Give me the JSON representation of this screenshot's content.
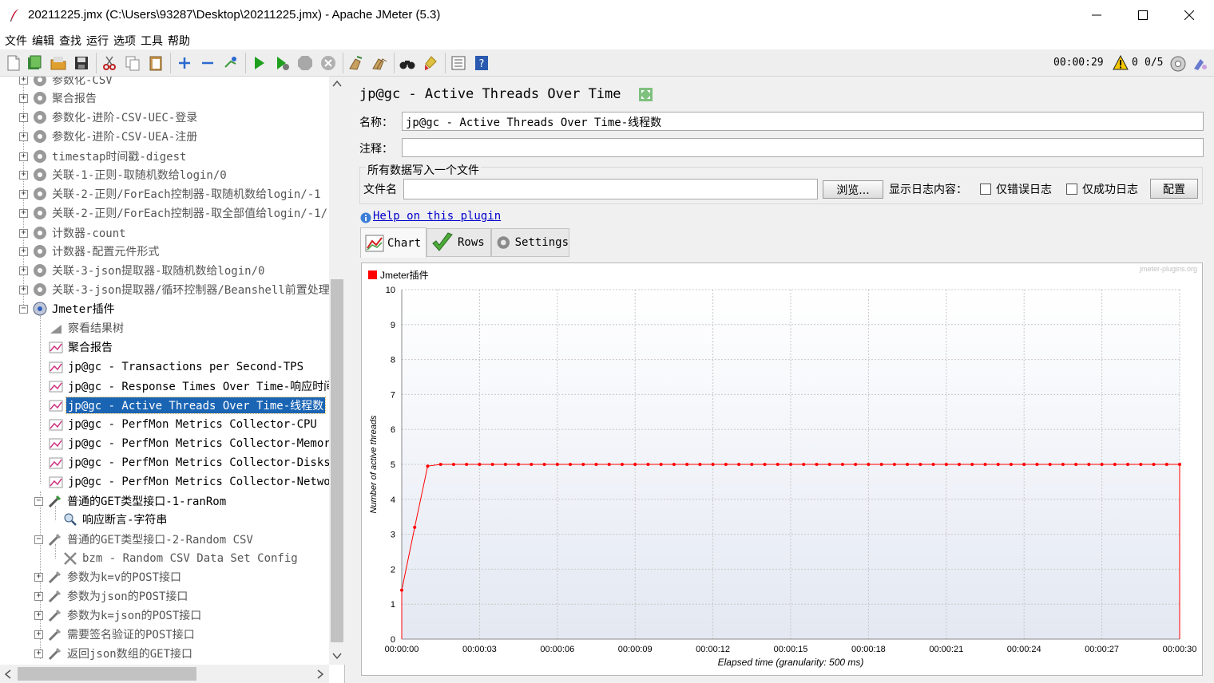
{
  "window": {
    "title": "20211225.jmx (C:\\Users\\93287\\Desktop\\20211225.jmx) - Apache JMeter (5.3)"
  },
  "menu": [
    "文件",
    "编辑",
    "查找",
    "运行",
    "选项",
    "工具",
    "帮助"
  ],
  "toolbar": {
    "timer": "00:00:29",
    "error_count": "0",
    "thread_count": "0/5"
  },
  "tree": {
    "items": [
      {
        "label": "参数化-CSV"
      },
      {
        "label": "聚合报告"
      },
      {
        "label": "参数化-进阶-CSV-UEC-登录"
      },
      {
        "label": "参数化-进阶-CSV-UEA-注册"
      },
      {
        "label": "timestap时间戳-digest"
      },
      {
        "label": "关联-1-正则-取随机数给login/0"
      },
      {
        "label": "关联-2-正则/ForEach控制器-取随机数给login/-1"
      },
      {
        "label": "关联-2-正则/ForEach控制器-取全部值给login/-1/"
      },
      {
        "label": "计数器-count"
      },
      {
        "label": "计数器-配置元件形式"
      },
      {
        "label": "关联-3-json提取器-取随机数给login/0"
      },
      {
        "label": "关联-3-json提取器/循环控制器/Beanshell前置处理"
      },
      {
        "label": "Jmeter插件"
      },
      {
        "label": "察看结果树"
      },
      {
        "label": "聚合报告"
      },
      {
        "label": "jp@gc - Transactions per Second-TPS"
      },
      {
        "label": "jp@gc - Response Times Over Time-响应时间"
      },
      {
        "label": "jp@gc - Active Threads Over Time-线程数"
      },
      {
        "label": "jp@gc - PerfMon Metrics Collector-CPU"
      },
      {
        "label": "jp@gc - PerfMon Metrics Collector-Memory"
      },
      {
        "label": "jp@gc - PerfMon Metrics Collector-Disks"
      },
      {
        "label": "jp@gc - PerfMon Metrics Collector-Network"
      },
      {
        "label": "普通的GET类型接口-1-ranRom"
      },
      {
        "label": "响应断言-字符串"
      },
      {
        "label": "普通的GET类型接口-2-Random CSV"
      },
      {
        "label": "bzm - Random CSV Data Set Config"
      },
      {
        "label": "参数为k=v的POST接口"
      },
      {
        "label": "参数为json的POST接口"
      },
      {
        "label": "参数为k=json的POST接口"
      },
      {
        "label": "需要签名验证的POST接口"
      },
      {
        "label": "返回json数组的GET接口"
      }
    ]
  },
  "panel": {
    "title": "jp@gc - Active Threads Over Time",
    "name_label": "名称：",
    "name_value": "jp@gc - Active Threads Over Time-线程数",
    "comment_label": "注释：",
    "comment_value": "",
    "file_group_title": "所有数据写入一个文件",
    "file_label": "文件名",
    "file_value": "",
    "browse_label": "浏览...",
    "log_label": "显示日志内容：",
    "errors_only_label": "仅错误日志",
    "success_only_label": "仅成功日志",
    "config_label": "配置",
    "help_link": "Help on this plugin",
    "tabs": [
      {
        "label": "Chart"
      },
      {
        "label": "Rows"
      },
      {
        "label": "Settings"
      }
    ]
  },
  "chart_data": {
    "type": "line",
    "watermark": "jmeter-plugins.org",
    "xlabel": "Elapsed time (granularity: 500 ms)",
    "ylabel": "Number of active threads",
    "xlim": [
      0,
      30
    ],
    "ylim": [
      0,
      10
    ],
    "x_ticks": [
      "00:00:00",
      "00:00:03",
      "00:00:06",
      "00:00:09",
      "00:00:12",
      "00:00:15",
      "00:00:18",
      "00:00:21",
      "00:00:24",
      "00:00:27",
      "00:00:30"
    ],
    "y_ticks": [
      "0",
      "1",
      "2",
      "3",
      "4",
      "5",
      "6",
      "7",
      "8",
      "9",
      "10"
    ],
    "grid": true,
    "legend": "top-left",
    "color": "#ff0000",
    "series": [
      {
        "name": "Jmeter插件",
        "x": [
          0,
          0.5,
          1,
          1.5,
          2,
          2.5,
          3,
          3.5,
          4,
          4.5,
          5,
          5.5,
          6,
          6.5,
          7,
          7.5,
          8,
          8.5,
          9,
          9.5,
          10,
          10.5,
          11,
          11.5,
          12,
          12.5,
          13,
          13.5,
          14,
          14.5,
          15,
          15.5,
          16,
          16.5,
          17,
          17.5,
          18,
          18.5,
          19,
          19.5,
          20,
          20.5,
          21,
          21.5,
          22,
          22.5,
          23,
          23.5,
          24,
          24.5,
          25,
          25.5,
          26,
          26.5,
          27,
          27.5,
          28,
          28.5,
          29,
          29.5,
          30
        ],
        "y": [
          1.4,
          3.2,
          4.95,
          5,
          5,
          5,
          5,
          5,
          5,
          5,
          5,
          5,
          5,
          5,
          5,
          5,
          5,
          5,
          5,
          5,
          5,
          5,
          5,
          5,
          5,
          5,
          5,
          5,
          5,
          5,
          5,
          5,
          5,
          5,
          5,
          5,
          5,
          5,
          5,
          5,
          5,
          5,
          5,
          5,
          5,
          5,
          5,
          5,
          5,
          5,
          5,
          5,
          5,
          5,
          5,
          5,
          5,
          5,
          5,
          5,
          5
        ]
      }
    ]
  }
}
